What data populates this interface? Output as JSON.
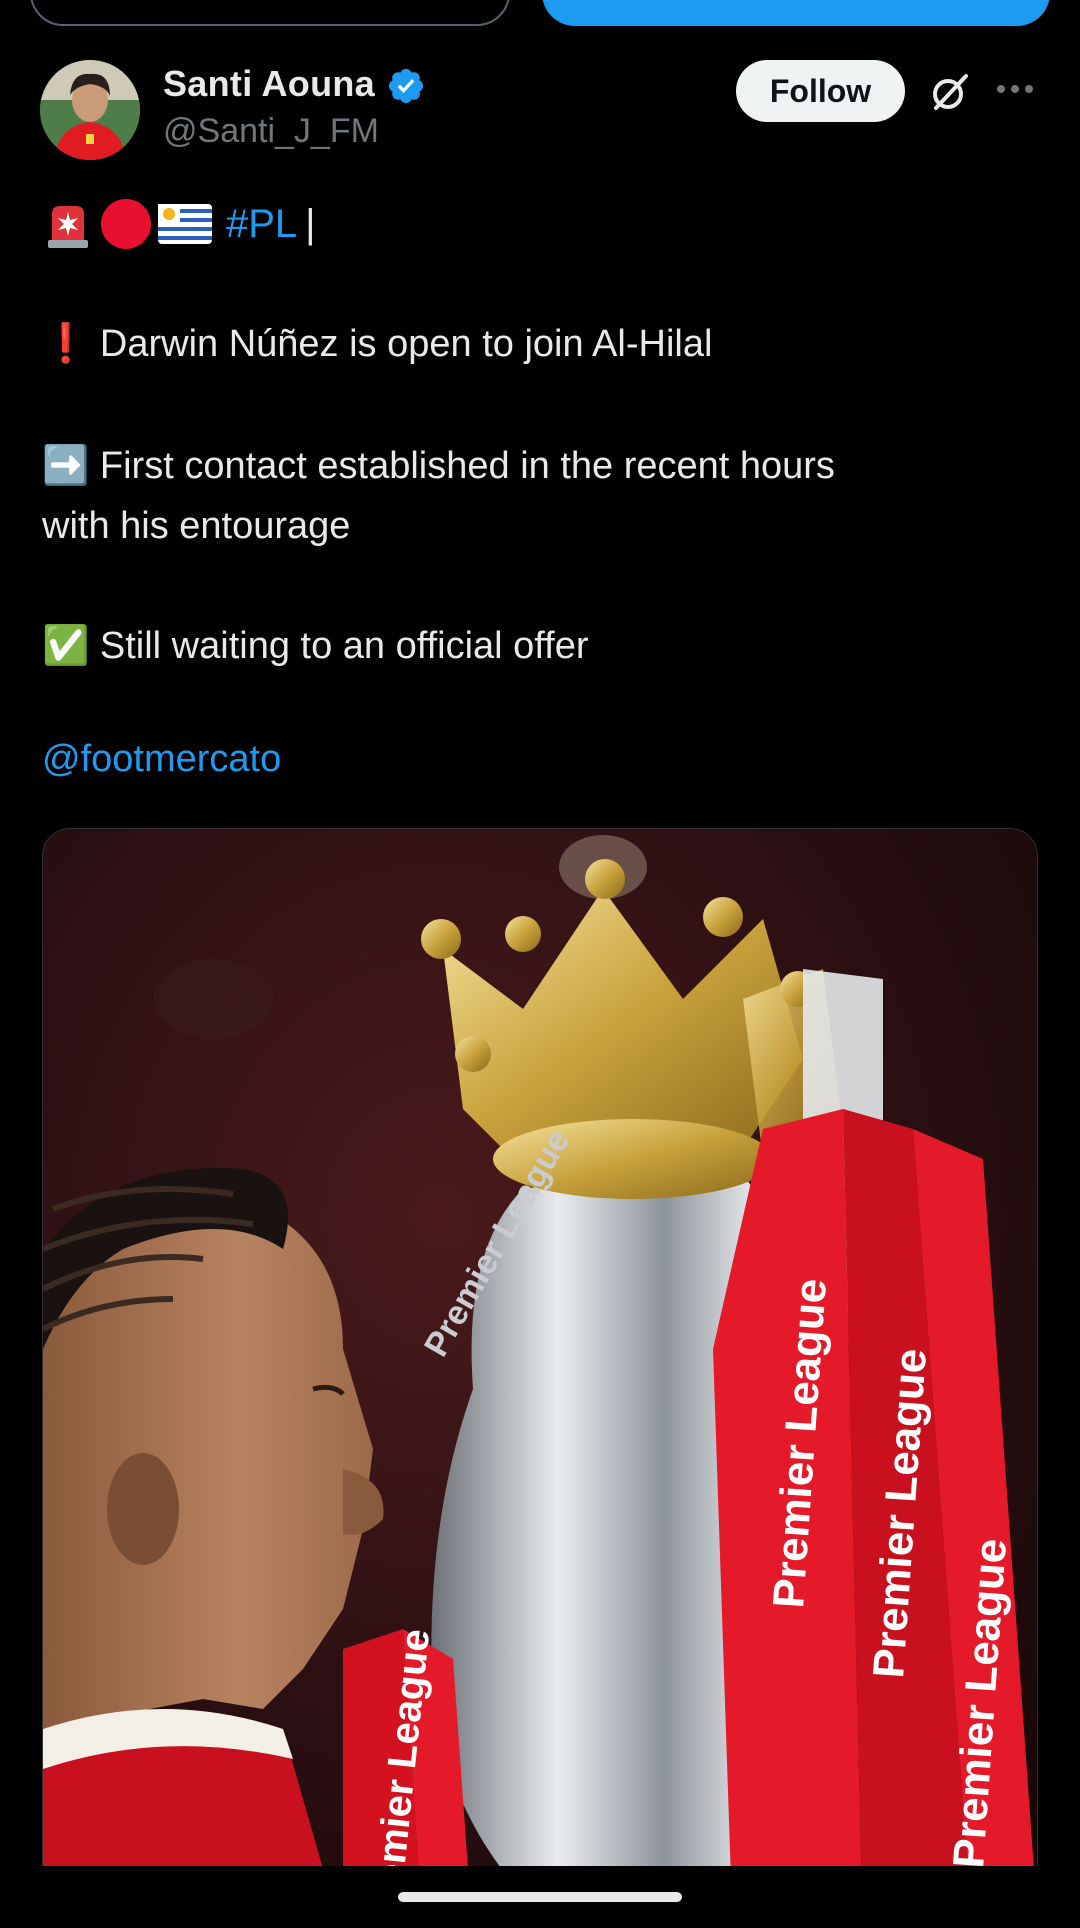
{
  "author": {
    "name": "Santi Aouna",
    "handle": "@Santi_J_FM",
    "verified": true
  },
  "actions": {
    "follow_label": "Follow"
  },
  "tweet": {
    "hashtag": "#PL",
    "cursor": "|",
    "line1_icon": "❗",
    "line1": "Darwin Núñez is open to join Al-Hilal",
    "line2_icon": "➡️",
    "line2a": "First contact established in the recent hours",
    "line2b": "with his entourage",
    "line3_icon": "✅",
    "line3": "Still waiting to an official offer",
    "mention": "@footmercato"
  },
  "media": {
    "ribbon_text": "Premier League",
    "trophy_engraving": "Premier League"
  },
  "colors": {
    "accent": "#1d9bf0",
    "text": "#e7e9ea",
    "muted": "#71767b",
    "background": "#000000"
  }
}
